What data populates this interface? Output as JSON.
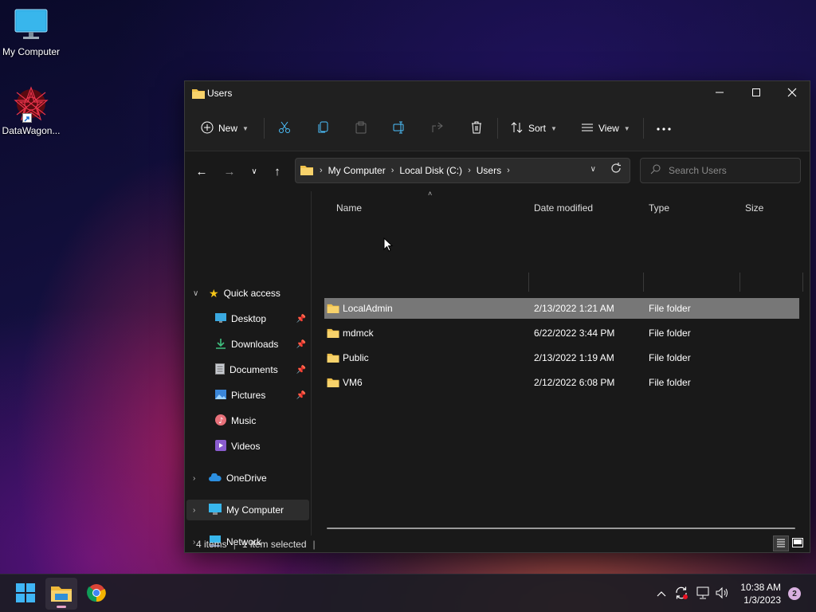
{
  "desktop": {
    "icons": [
      {
        "label": "My Computer"
      },
      {
        "label": "DataWagon..."
      }
    ]
  },
  "window": {
    "title": "Users",
    "controls": {
      "minimize": "minimize-icon",
      "maximize": "maximize-icon",
      "close": "close-icon"
    }
  },
  "toolbar": {
    "new_label": "New",
    "sort_label": "Sort",
    "view_label": "View",
    "icons": [
      "cut-icon",
      "copy-icon",
      "paste-icon",
      "rename-icon",
      "share-icon",
      "delete-icon",
      "more-icon"
    ]
  },
  "address": {
    "crumbs": [
      "My Computer",
      "Local Disk (C:)",
      "Users"
    ],
    "search_placeholder": "Search Users"
  },
  "nav": {
    "quick_access": "Quick access",
    "items": [
      {
        "label": "Desktop",
        "pinned": true
      },
      {
        "label": "Downloads",
        "pinned": true
      },
      {
        "label": "Documents",
        "pinned": true
      },
      {
        "label": "Pictures",
        "pinned": true
      },
      {
        "label": "Music",
        "pinned": false
      },
      {
        "label": "Videos",
        "pinned": false
      }
    ],
    "onedrive": "OneDrive",
    "my_computer": "My Computer",
    "network": "Network"
  },
  "columns": {
    "name": "Name",
    "date": "Date modified",
    "type": "Type",
    "size": "Size"
  },
  "files": [
    {
      "name": "LocalAdmin",
      "date": "2/13/2022 1:21 AM",
      "type": "File folder",
      "selected": true
    },
    {
      "name": "mdmck",
      "date": "6/22/2022 3:44 PM",
      "type": "File folder",
      "selected": false
    },
    {
      "name": "Public",
      "date": "2/13/2022 1:19 AM",
      "type": "File folder",
      "selected": false
    },
    {
      "name": "VM6",
      "date": "2/12/2022 6:08 PM",
      "type": "File folder",
      "selected": false
    }
  ],
  "status": {
    "items": "4 items",
    "selected": "1 item selected"
  },
  "taskbar": {
    "time": "10:38 AM",
    "date": "1/3/2023",
    "notifications": "2"
  },
  "colors": {
    "folder": "#f0c14b",
    "selection": "#777777",
    "accent": "#4cc2ff"
  }
}
